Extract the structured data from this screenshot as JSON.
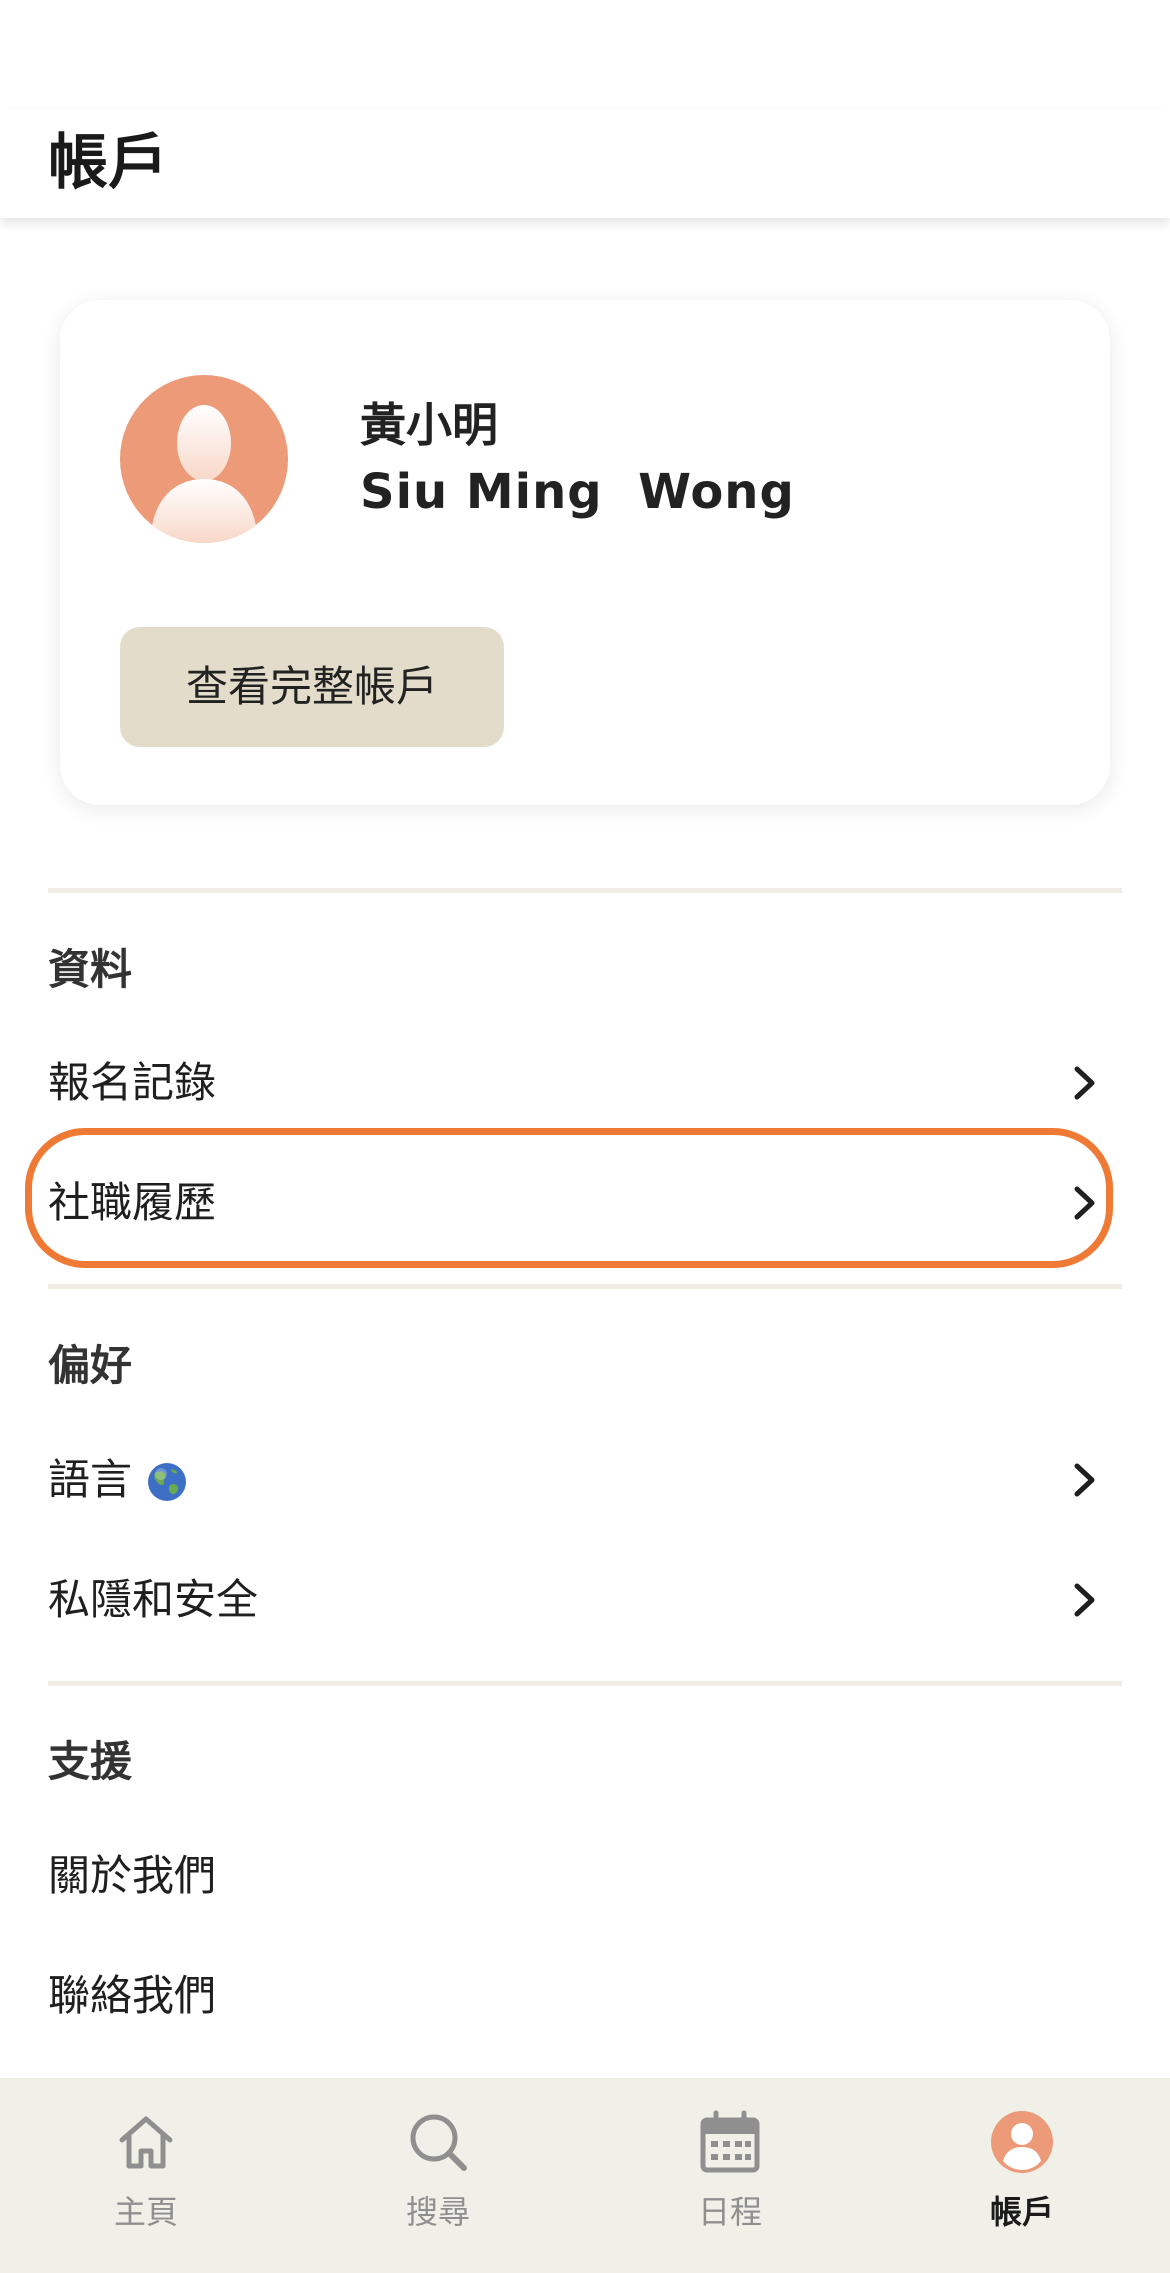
{
  "header": {
    "title": "帳戶"
  },
  "profile": {
    "name_zh": "黃小明",
    "name_en": "Siu Ming  Wong",
    "view_button": "查看完整帳戶",
    "avatar_color": "#ec9a78"
  },
  "sections": {
    "info": {
      "title": "資料",
      "items": [
        {
          "label": "報名記錄"
        },
        {
          "label": "社職履歷"
        }
      ]
    },
    "preferences": {
      "title": "偏好",
      "items": [
        {
          "label": "語言",
          "icon": "globe-icon"
        },
        {
          "label": "私隱和安全"
        }
      ]
    },
    "support": {
      "title": "支援",
      "items": [
        {
          "label": "關於我們"
        },
        {
          "label": "聯絡我們"
        }
      ]
    }
  },
  "highlight_color": "#ef7a35",
  "bottom_nav": {
    "items": [
      {
        "label": "主頁",
        "icon": "home-icon"
      },
      {
        "label": "搜尋",
        "icon": "search-icon"
      },
      {
        "label": "日程",
        "icon": "calendar-icon"
      },
      {
        "label": "帳戶",
        "icon": "account-icon",
        "active": true
      }
    ]
  }
}
